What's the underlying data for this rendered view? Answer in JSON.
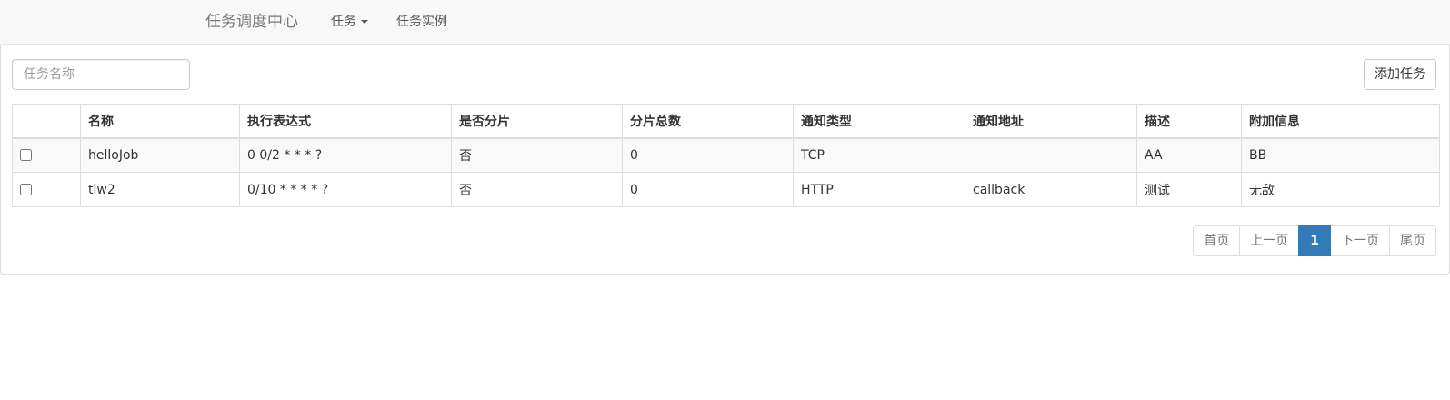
{
  "navbar": {
    "brand": "任务调度中心",
    "items": [
      {
        "label": "任务",
        "has_dropdown": true
      },
      {
        "label": "任务实例",
        "has_dropdown": false
      }
    ]
  },
  "toolbar": {
    "search_placeholder": "任务名称",
    "search_value": "",
    "add_label": "添加任务"
  },
  "table": {
    "columns": [
      "",
      "名称",
      "执行表达式",
      "是否分片",
      "分片总数",
      "通知类型",
      "通知地址",
      "描述",
      "附加信息"
    ],
    "rows": [
      {
        "checked": false,
        "name": "helloJob",
        "cron": "0 0/2 * * * ?",
        "sharding": "否",
        "shard_total": "0",
        "notify_type": "TCP",
        "notify_address": "",
        "description": "AA",
        "extra": "BB"
      },
      {
        "checked": false,
        "name": "tlw2",
        "cron": "0/10 * * * * ?",
        "sharding": "否",
        "shard_total": "0",
        "notify_type": "HTTP",
        "notify_address": "callback",
        "description": "测试",
        "extra": "无敌"
      }
    ]
  },
  "pagination": {
    "first": "首页",
    "prev": "上一页",
    "current": "1",
    "next": "下一页",
    "last": "尾页"
  },
  "colors": {
    "navbar_bg": "#f8f8f8",
    "active_page": "#337ab7",
    "striped_row": "#f9f9f9"
  },
  "icons": {
    "dropdown": "caret-down-icon"
  }
}
